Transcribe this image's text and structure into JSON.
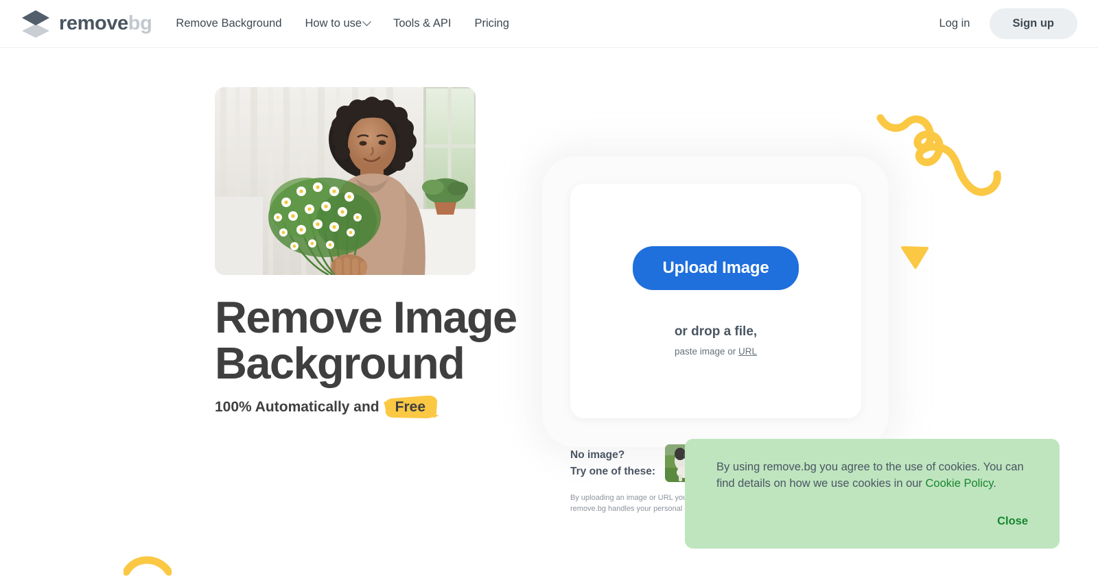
{
  "navbar": {
    "brand": {
      "word1": "remove",
      "word2": "bg"
    },
    "links": [
      {
        "label": "Remove Background",
        "has_chevron": false
      },
      {
        "label": "How to use",
        "has_chevron": true
      },
      {
        "label": "Tools & API",
        "has_chevron": false
      },
      {
        "label": "Pricing",
        "has_chevron": false
      }
    ],
    "login_label": "Log in",
    "signup_label": "Sign up"
  },
  "hero": {
    "title_line1": "Remove Image",
    "title_line2": "Background",
    "subtitle_prefix": "100% Automatically and",
    "subtitle_highlight": "Free",
    "photo_alt": "Woman holding a bouquet of white daisies in a bright room"
  },
  "upload": {
    "button_label": "Upload Image",
    "drop_label": "or drop a file,",
    "paste_prefix": "paste image or",
    "paste_link": "URL"
  },
  "samples": {
    "line1": "No image?",
    "line2": "Try one of these:",
    "thumbnail_alt": "dog on grass"
  },
  "fineprint": {
    "line1": "By uploading an image or URL you a",
    "line2": "remove.bg handles your personal d"
  },
  "cookie": {
    "text_before": "By using remove.bg you agree to the use of cookies. You can find details on how we use cookies in our ",
    "link_label": "Cookie Policy",
    "text_after": ".",
    "close_label": "Close"
  },
  "colors": {
    "accent_blue": "#1f6fdd",
    "brand_dark": "#4a5562",
    "brand_light": "#c2c8cf",
    "highlight_yellow": "#fbc844",
    "cookie_bg": "#bfe5bf",
    "cookie_green": "#17862f",
    "heading": "#3f3f3f"
  },
  "icons": {
    "logo": "stacked-diamonds-icon",
    "chevron": "chevron-down-icon",
    "squiggle": "squiggle-decoration-icon",
    "triangle": "triangle-down-decoration-icon",
    "arc": "arc-decoration-icon"
  }
}
